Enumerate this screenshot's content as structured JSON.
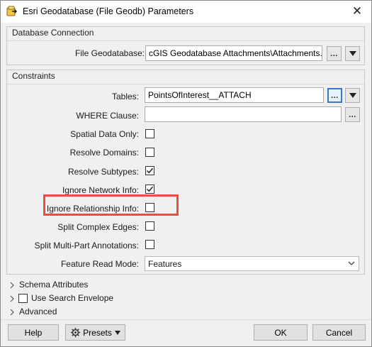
{
  "window": {
    "title": "Esri Geodatabase (File Geodb) Parameters",
    "close_symbol": "✕"
  },
  "database_connection": {
    "section_title": "Database Connection",
    "file_geodatabase_label": "File Geodatabase:",
    "file_geodatabase_value": "cGIS Geodatabase Attachments\\Attachments.gdb\"",
    "browse_label": "...",
    "dropdown_icon": "triangle-down-icon"
  },
  "constraints": {
    "section_title": "Constraints",
    "tables_label": "Tables:",
    "tables_value": "PointsOfInterest__ATTACH",
    "tables_browse_label": "...",
    "where_label": "WHERE Clause:",
    "where_value": "",
    "where_browse_label": "...",
    "options": [
      {
        "label": "Spatial Data Only:",
        "checked": false
      },
      {
        "label": "Resolve Domains:",
        "checked": false
      },
      {
        "label": "Resolve Subtypes:",
        "checked": true
      },
      {
        "label": "Ignore Network Info:",
        "checked": true
      },
      {
        "label": "Ignore Relationship Info:",
        "checked": false,
        "highlighted": true
      },
      {
        "label": "Split Complex Edges:",
        "checked": false
      },
      {
        "label": "Split Multi-Part Annotations:",
        "checked": false
      }
    ],
    "feature_read_mode_label": "Feature Read Mode:",
    "feature_read_mode_value": "Features"
  },
  "collapsed_sections": {
    "schema_attributes": "Schema Attributes",
    "use_search_envelope": "Use Search Envelope",
    "use_search_envelope_checked": false,
    "advanced": "Advanced"
  },
  "footer": {
    "help": "Help",
    "presets": "Presets",
    "ok": "OK",
    "cancel": "Cancel"
  },
  "colors": {
    "highlight": "#e84f3d",
    "focus_border": "#3a78c6"
  }
}
